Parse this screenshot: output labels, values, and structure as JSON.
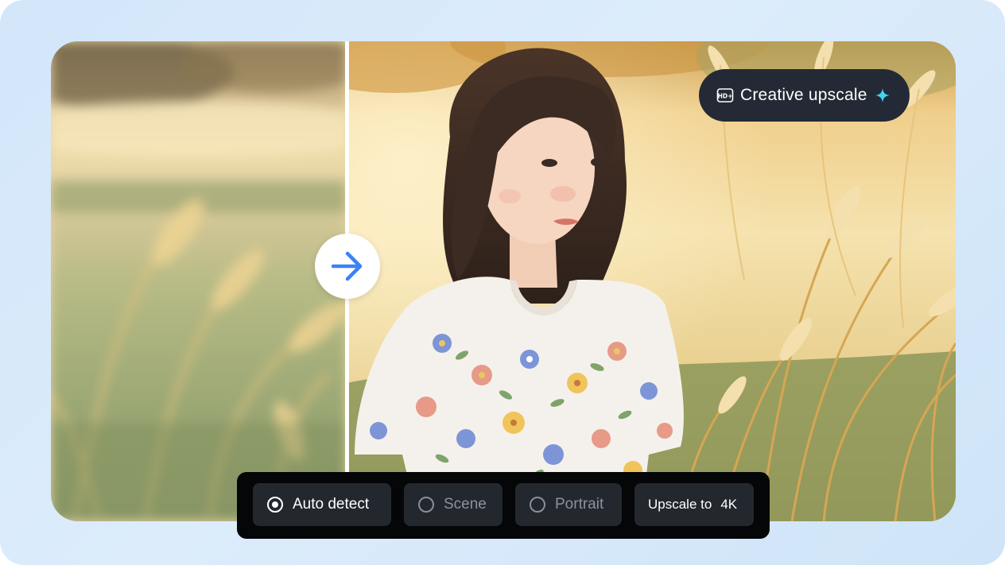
{
  "badge": {
    "label": "Creative upscale",
    "icon": "hd-plus-icon",
    "accent_icon": "sparkle-icon",
    "accent_color": "#3fd6f2"
  },
  "compare": {
    "handle_icon": "arrow-right-icon",
    "handle_color": "#3b82f6"
  },
  "options": {
    "auto_detect": "Auto detect",
    "scene": "Scene",
    "portrait": "Portrait",
    "selected": "Auto detect"
  },
  "upscale": {
    "label": "Upscale to",
    "value": "4K"
  }
}
